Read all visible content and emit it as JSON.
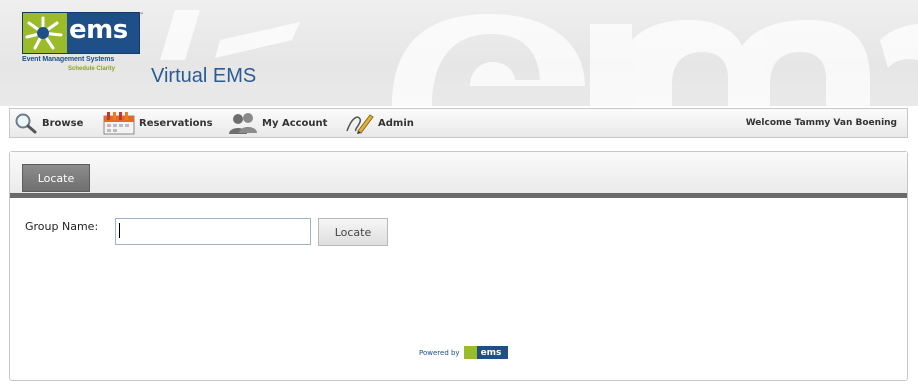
{
  "header": {
    "logo": {
      "word": "ems",
      "trademark": "™",
      "tagline": "Event Management Systems",
      "subtagline": "Schedule Clarity"
    },
    "app_title": "Virtual EMS"
  },
  "nav": {
    "items": [
      {
        "label": "Browse",
        "icon": "magnifier-icon"
      },
      {
        "label": "Reservations",
        "icon": "calendar-icon"
      },
      {
        "label": "My Account",
        "icon": "users-icon"
      },
      {
        "label": "Admin",
        "icon": "pen-icon"
      }
    ],
    "welcome": "Welcome Tammy Van Boening"
  },
  "panel": {
    "tab_label": "Locate",
    "field_label": "Group Name:",
    "group_name_value": "",
    "locate_button": "Locate"
  },
  "footer": {
    "powered_by": "Powered by",
    "logo_word": "ems"
  },
  "colors": {
    "brand_blue": "#1e4f86",
    "brand_green": "#9cbb2a",
    "title_blue": "#2a5c92",
    "tab_gray": "#7a7a7a"
  }
}
